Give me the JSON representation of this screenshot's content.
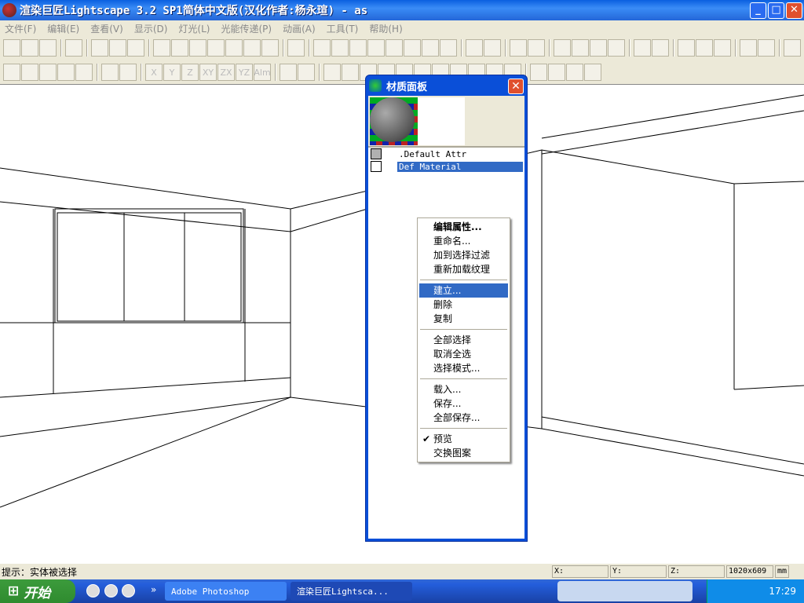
{
  "window": {
    "title": "渲染巨匠Lightscape 3.2 SP1简体中文版(汉化作者:杨永瑄) - as"
  },
  "menu": [
    "文件(F)",
    "编辑(E)",
    "查看(V)",
    "显示(D)",
    "灯光(L)",
    "光能传递(P)",
    "动画(A)",
    "工具(T)",
    "帮助(H)"
  ],
  "toolbar2": {
    "axis": [
      "X",
      "Y",
      "Z",
      "XY",
      "ZX",
      "YZ",
      "Alm"
    ]
  },
  "panel": {
    "title": "材质面板",
    "close": "✕",
    "materials": [
      {
        "name": ".Default Attr",
        "color": "#b0b0b0"
      },
      {
        "name": "Def Material",
        "color": "#ffffff",
        "selected": true
      }
    ]
  },
  "context_menu": {
    "groups": [
      [
        {
          "label": "编辑属性...",
          "bold": true
        },
        {
          "label": "重命名..."
        },
        {
          "label": "加到选择过滤"
        },
        {
          "label": "重新加载纹理"
        }
      ],
      [
        {
          "label": "建立...",
          "highlighted": true
        },
        {
          "label": "删除"
        },
        {
          "label": "复制"
        }
      ],
      [
        {
          "label": "全部选择"
        },
        {
          "label": "取消全选"
        },
        {
          "label": "选择模式..."
        }
      ],
      [
        {
          "label": "载入..."
        },
        {
          "label": "保存..."
        },
        {
          "label": "全部保存..."
        }
      ],
      [
        {
          "label": "预览",
          "checked": true
        },
        {
          "label": "交换图案"
        }
      ]
    ]
  },
  "status": {
    "hint": "提示：实体被选择",
    "x": "X:",
    "y": "Y:",
    "z": "Z:",
    "size": "1020x609",
    "unit": "mm"
  },
  "taskbar": {
    "start": "开始",
    "tasks": [
      "Adobe Photoshop",
      "渲染巨匠Lightsca..."
    ],
    "clock": "17:29",
    "chevron": "»"
  }
}
